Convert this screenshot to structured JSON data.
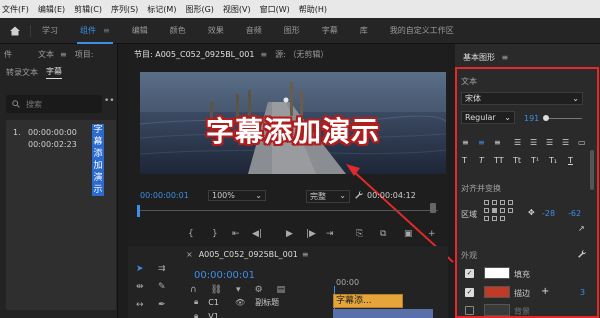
{
  "menu": [
    "文件(F)",
    "编辑(E)",
    "剪辑(C)",
    "序列(S)",
    "标记(M)",
    "图形(G)",
    "视图(V)",
    "窗口(W)",
    "帮助(H)"
  ],
  "workspaces": [
    "学习",
    "组件",
    "编辑",
    "颜色",
    "效果",
    "音频",
    "图形",
    "字幕",
    "库",
    "我的自定义工作区"
  ],
  "left_panel": {
    "tabs": [
      "件",
      "文本",
      "项目:"
    ],
    "subtabs": [
      "转录文本",
      "字幕"
    ],
    "search_placeholder": "搜索",
    "caption": {
      "index": "1.",
      "start": "00:00:00:00",
      "end": "00:00:02:23",
      "text": "字幕添加演示"
    }
  },
  "program": {
    "tab": "节目: A005_C052_0925BL_001",
    "source_tab": "源: （无剪辑）",
    "caption_text": "字幕添加演示",
    "current_time": "00:00:00:01",
    "zoom": "100%",
    "quality": "完整",
    "duration": "00:00:04:12"
  },
  "timeline": {
    "sequence": "A005_C052_0925BL_001",
    "time": "00:00:00:01",
    "ruler_label": "00:00",
    "track_c1": "C1",
    "track_v1": "V1",
    "track_name": "副标题",
    "clip_label": "字幕添..."
  },
  "essential_graphics": {
    "title": "基本图形",
    "section_text": "文本",
    "font": "宋体",
    "style": "Regular",
    "size": "191",
    "align_label": "对齐并变换",
    "area_label": "区域",
    "pos_x": "-28",
    "pos_y": "-62",
    "appearance_label": "外观",
    "fill_label": "填充",
    "stroke_label": "描边",
    "shadow_label": "背景",
    "stroke_size": "3",
    "colors": {
      "fill": "#ffffff",
      "stroke": "#c03a26",
      "highlight": "#e22a2a",
      "accent": "#3d8ee6"
    }
  }
}
